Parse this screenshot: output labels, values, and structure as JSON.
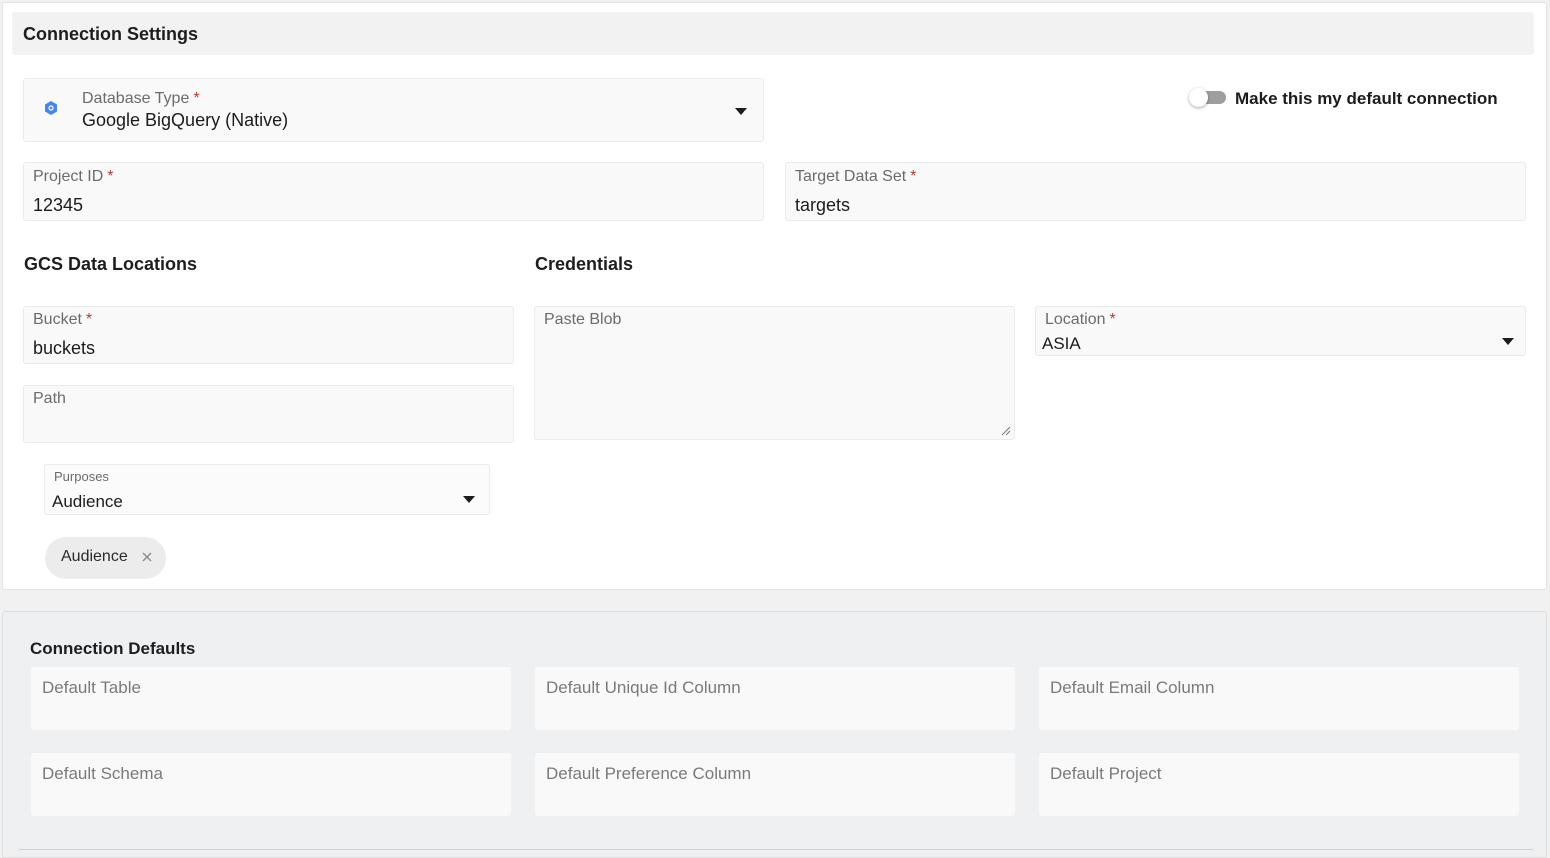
{
  "header": {
    "title": "Connection Settings"
  },
  "database_type": {
    "label": "Database Type",
    "required_mark": "*",
    "value": "Google BigQuery (Native)",
    "icon": "bigquery-icon"
  },
  "default_toggle": {
    "label": "Make this my default connection",
    "checked": false
  },
  "project_id": {
    "label": "Project ID",
    "required_mark": "*",
    "value": "12345"
  },
  "target_data_set": {
    "label": "Target Data Set",
    "required_mark": "*",
    "value": "targets"
  },
  "gcs": {
    "heading": "GCS Data Locations",
    "bucket": {
      "label": "Bucket",
      "required_mark": "*",
      "value": "buckets"
    },
    "path": {
      "label": "Path",
      "value": ""
    },
    "purposes": {
      "label": "Purposes",
      "value": "Audience"
    },
    "chips": [
      {
        "label": "Audience"
      }
    ]
  },
  "credentials": {
    "heading": "Credentials",
    "blob": {
      "placeholder": "Paste Blob"
    },
    "location": {
      "label": "Location",
      "required_mark": "*",
      "value": "ASIA"
    }
  },
  "defaults": {
    "title": "Connection Defaults",
    "fields": [
      {
        "label": "Default Table"
      },
      {
        "label": "Default Unique Id Column"
      },
      {
        "label": "Default Email Column"
      },
      {
        "label": "Default Schema"
      },
      {
        "label": "Default Preference Column"
      },
      {
        "label": "Default Project"
      }
    ]
  },
  "colors": {
    "required": "#c0392b",
    "toggle_off": "#9e9e9e",
    "icon_blue": "#4285f4"
  }
}
